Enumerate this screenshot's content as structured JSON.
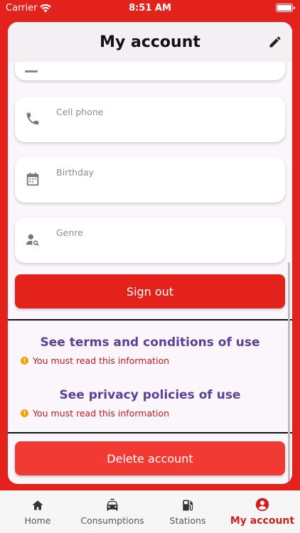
{
  "status_bar": {
    "carrier": "Carrier",
    "time": "8:51 AM"
  },
  "header": {
    "title": "My account"
  },
  "fields": [
    {
      "label": "Cell phone",
      "icon": "phone-icon"
    },
    {
      "label": "Birthday",
      "icon": "calendar-icon"
    },
    {
      "label": "Genre",
      "icon": "person-search-icon"
    }
  ],
  "sign_out_label": "Sign out",
  "terms": {
    "title": "See terms and conditions of use",
    "warning": "You must read this information"
  },
  "privacy": {
    "title": "See privacy policies of use",
    "warning": "You must read this information"
  },
  "delete_label": "Delete account",
  "tabs": [
    {
      "label": "Home",
      "icon": "home-icon"
    },
    {
      "label": "Consumptions",
      "icon": "car-icon"
    },
    {
      "label": "Stations",
      "icon": "fuel-pump-icon"
    },
    {
      "label": "My account",
      "icon": "account-icon",
      "active": true
    }
  ],
  "colors": {
    "accent": "#e3231b",
    "link": "#5b3f96",
    "warning_text": "#c0191a",
    "warning_dot": "#f3a300"
  }
}
